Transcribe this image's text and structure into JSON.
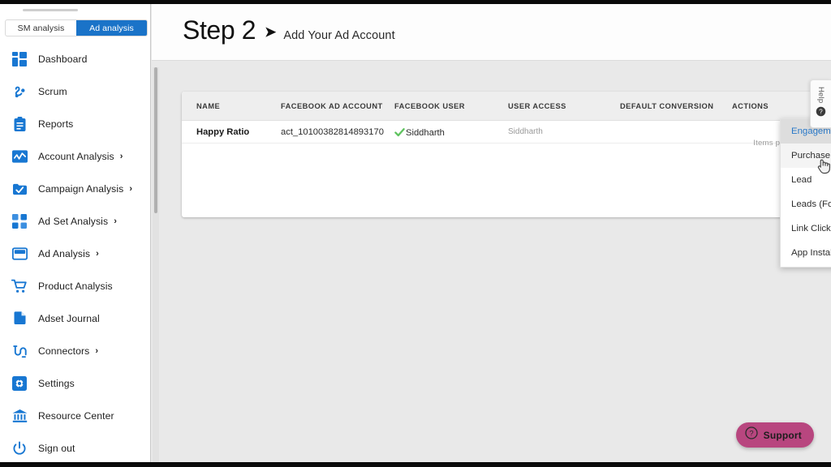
{
  "brand": {
    "accent_blue": "#1a73c8",
    "icon_blue": "#1877d2",
    "check_green": "#5fc35f",
    "support_magenta": "#b8467f",
    "page_bg": "#e9e9e9"
  },
  "sidebar": {
    "tabs": [
      {
        "label": "SM analysis",
        "active": false
      },
      {
        "label": "Ad analysis",
        "active": true
      }
    ],
    "items": [
      {
        "label": "Dashboard",
        "icon": "grid-icon",
        "chevron": ""
      },
      {
        "label": "Scrum",
        "icon": "scrum-icon",
        "chevron": ""
      },
      {
        "label": "Reports",
        "icon": "clipboard-icon",
        "chevron": ""
      },
      {
        "label": "Account Analysis",
        "icon": "chart-line-icon",
        "chevron": "›"
      },
      {
        "label": "Campaign Analysis",
        "icon": "check-badge-icon",
        "chevron": "›"
      },
      {
        "label": "Ad Set Analysis",
        "icon": "four-squares-icon",
        "chevron": "›"
      },
      {
        "label": "Ad Analysis",
        "icon": "window-icon",
        "chevron": "›"
      },
      {
        "label": "Product Analysis",
        "icon": "cart-icon",
        "chevron": ""
      },
      {
        "label": "Adset Journal",
        "icon": "document-icon",
        "chevron": ""
      },
      {
        "label": "Connectors",
        "icon": "connector-icon",
        "chevron": "›"
      },
      {
        "label": "Settings",
        "icon": "gear-icon",
        "chevron": ""
      },
      {
        "label": "Resource Center",
        "icon": "bank-icon",
        "chevron": ""
      },
      {
        "label": "Sign out",
        "icon": "power-icon",
        "chevron": ""
      }
    ]
  },
  "header": {
    "step": "Step 2",
    "arrow": "➤",
    "subtitle": "Add Your Ad Account"
  },
  "table": {
    "columns": [
      "NAME",
      "FACEBOOK AD ACCOUNT",
      "FACEBOOK USER",
      "USER ACCESS",
      "DEFAULT CONVERSION",
      "ACTIONS"
    ],
    "rows": [
      {
        "name": "Happy Ratio",
        "facebook_ad_account": "act_10100382814893170",
        "facebook_user": "Siddharth",
        "facebook_user_verified": true,
        "user_access": "Siddharth",
        "default_conversion": "",
        "actions": ""
      }
    ],
    "items_per_page_label": "Items per pa"
  },
  "dropdown": {
    "name": "default-conversion-dropdown",
    "options": [
      {
        "label": "Engagement",
        "state": "selected"
      },
      {
        "label": "Purchase",
        "state": "hover"
      },
      {
        "label": "Lead",
        "state": ""
      },
      {
        "label": "Leads (Forms)",
        "state": ""
      },
      {
        "label": "Link Clicks",
        "state": ""
      },
      {
        "label": "App Installs",
        "state": ""
      }
    ]
  },
  "help_tab": {
    "label": "Help"
  },
  "support": {
    "label": "Support"
  }
}
